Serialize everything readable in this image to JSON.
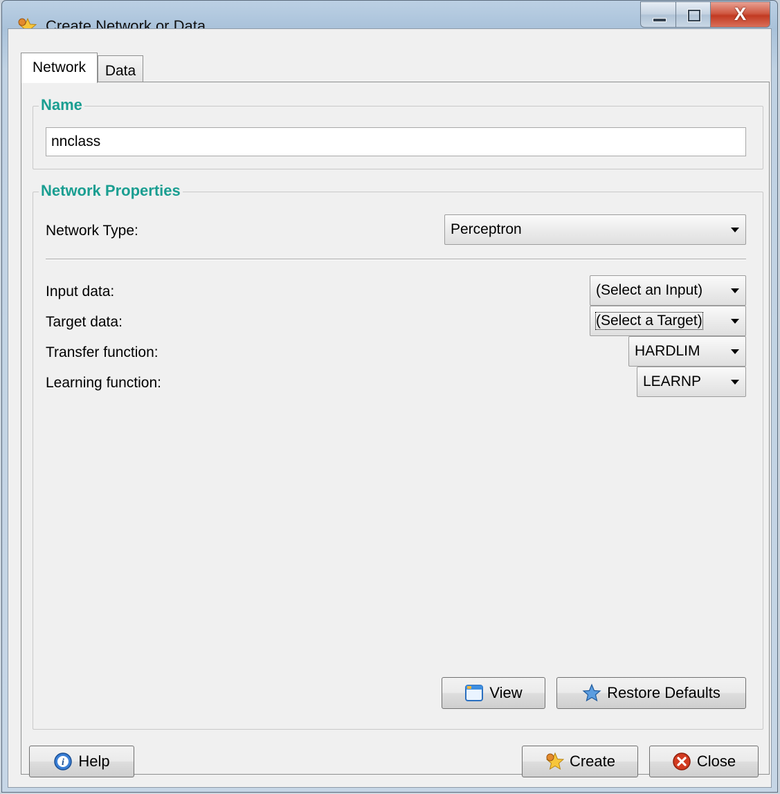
{
  "window": {
    "title": "Create Network or Data",
    "controls": {
      "minimize": "minimize",
      "maximize": "maximize",
      "close": "X"
    }
  },
  "tabs": [
    {
      "label": "Network",
      "active": true
    },
    {
      "label": "Data",
      "active": false
    }
  ],
  "name_group": {
    "legend": "Name",
    "value": "nnclass"
  },
  "props_group": {
    "legend": "Network Properties",
    "network_type": {
      "label": "Network Type:",
      "value": "Perceptron"
    },
    "input_data": {
      "label": "Input data:",
      "value": "(Select an Input)"
    },
    "target_data": {
      "label": "Target data:",
      "value": "(Select a Target)"
    },
    "transfer_function": {
      "label": "Transfer function:",
      "value": "HARDLIM"
    },
    "learning_function": {
      "label": "Learning function:",
      "value": "LEARNP"
    },
    "view_label": "View",
    "restore_label": "Restore Defaults"
  },
  "footer": {
    "help_label": "Help",
    "create_label": "Create",
    "close_label": "Close"
  },
  "icons": {
    "app": "star-icon",
    "help": "info-icon",
    "view": "window-icon",
    "restore": "star-icon",
    "create": "star-icon",
    "close": "close-circle-icon"
  },
  "colors": {
    "legend": "#1a9e91",
    "close_button": "#c23a22"
  }
}
